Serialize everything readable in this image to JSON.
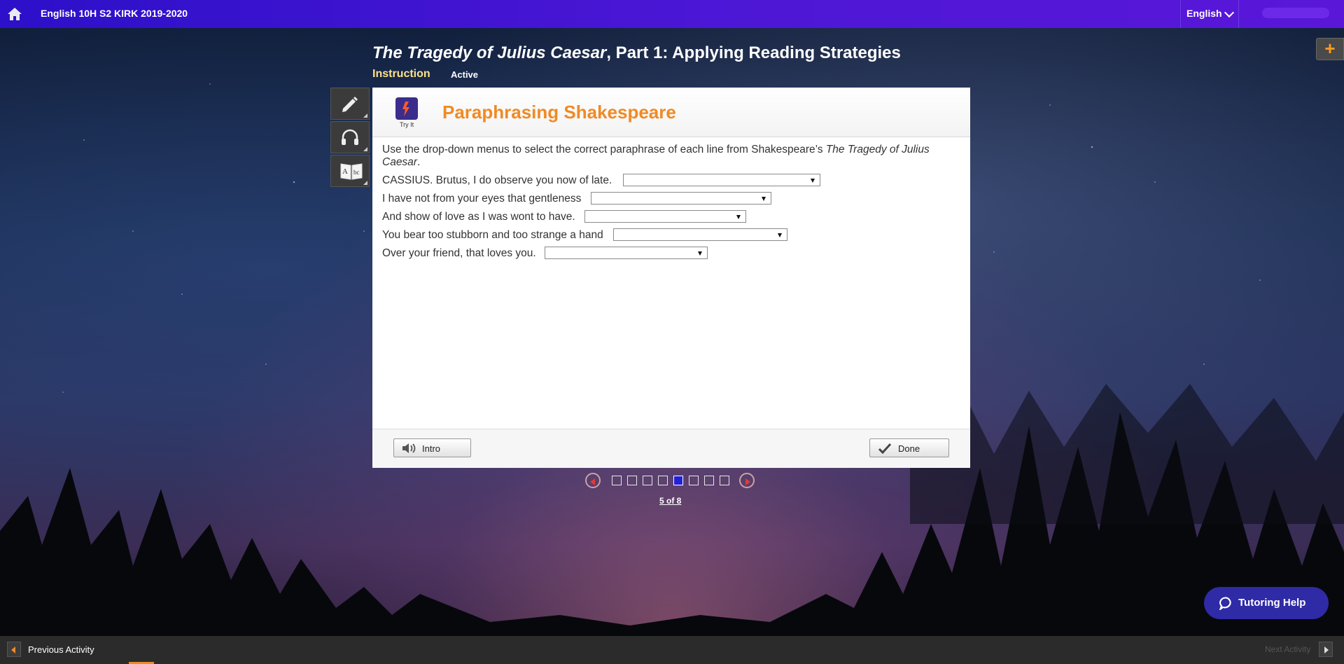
{
  "topbar": {
    "course_title": "English 10H S2 KIRK 2019-2020",
    "language": "English"
  },
  "activity": {
    "title_italic": "The Tragedy of Julius Caesar",
    "title_rest": ", Part 1: Applying Reading Strategies",
    "tab_instruction": "Instruction",
    "tab_active": "Active"
  },
  "tools": [
    "pencil-icon",
    "headphones-icon",
    "dictionary-icon"
  ],
  "panel": {
    "badge_label": "Try It",
    "heading": "Paraphrasing Shakespeare",
    "instructions_prefix": "Use the drop-down menus to select the correct paraphrase of each line from Shakespeare’s ",
    "instructions_italic": "The Tragedy of Julius Caesar",
    "instructions_suffix": ".",
    "lines": [
      {
        "text": "CASSIUS. Brutus, I do observe you now of late.",
        "selected": ""
      },
      {
        "text": "I have not from your eyes that gentleness",
        "selected": ""
      },
      {
        "text": "And show of love as I was wont to have.",
        "selected": ""
      },
      {
        "text": "You bear too stubborn and too strange a hand",
        "selected": ""
      },
      {
        "text": "Over your friend, that loves you.",
        "selected": ""
      }
    ],
    "intro_button": "Intro",
    "done_button": "Done"
  },
  "pager": {
    "total": 8,
    "current": 5,
    "label": "5 of 8"
  },
  "tutoring_button": "Tutoring Help",
  "bottombar": {
    "previous_label": "Previous Activity",
    "next_label": "Next Activity"
  },
  "colors": {
    "topbar": "#3a13cf",
    "heading": "#f08a24",
    "current_page": "#2320d6",
    "tutoring": "#2f2aa6"
  }
}
